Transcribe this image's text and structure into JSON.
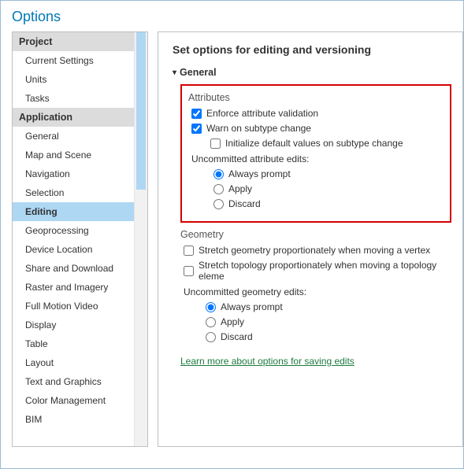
{
  "window": {
    "title": "Options"
  },
  "sidebar": {
    "headers": {
      "project": "Project",
      "application": "Application"
    },
    "project_items": [
      "Current Settings",
      "Units",
      "Tasks"
    ],
    "app_items": [
      "General",
      "Map and Scene",
      "Navigation",
      "Selection",
      "Editing",
      "Geoprocessing",
      "Device Location",
      "Share and Download",
      "Raster and Imagery",
      "Full Motion Video",
      "Display",
      "Table",
      "Layout",
      "Text and Graphics",
      "Color Management",
      "BIM"
    ],
    "selected": "Editing"
  },
  "main": {
    "heading": "Set options for editing and versioning",
    "group_general": "General",
    "attributes": {
      "title": "Attributes",
      "enforce": "Enforce attribute validation",
      "warn": "Warn on subtype change",
      "init": "Initialize default values on subtype change",
      "uncommitted_label": "Uncommitted attribute edits:",
      "opts": {
        "always": "Always prompt",
        "apply": "Apply",
        "discard": "Discard"
      }
    },
    "geometry": {
      "title": "Geometry",
      "stretch_geom": "Stretch geometry proportionately when moving a vertex",
      "stretch_topo": "Stretch topology proportionately when moving a topology eleme",
      "uncommitted_label": "Uncommitted geometry edits:",
      "opts": {
        "always": "Always prompt",
        "apply": "Apply",
        "discard": "Discard"
      }
    },
    "link": "Learn more about options for saving edits"
  }
}
